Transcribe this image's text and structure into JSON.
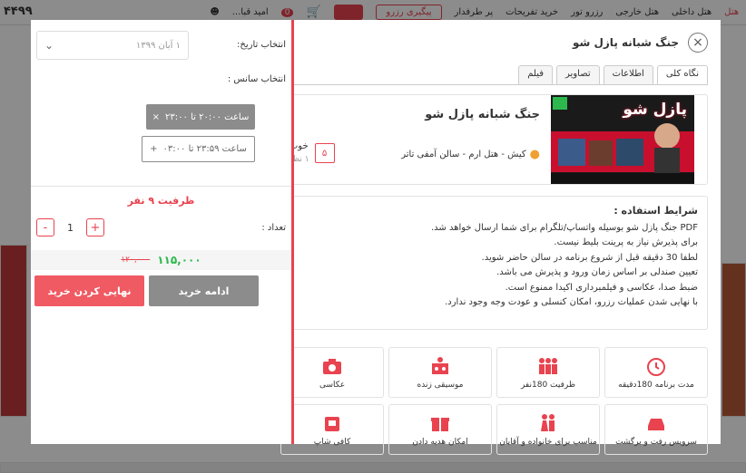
{
  "topbar": {
    "phone": "۴۴۹۹",
    "user": "امید قبا...",
    "cart_count": "0",
    "nav": [
      "هتل داخلی",
      "هتل خارجی",
      "رزرو تور",
      "خرید تفریحات",
      "پر طرفدار"
    ],
    "track_label": "پیگیری رزرو",
    "first_label": "هتل"
  },
  "modal": {
    "title": "جنگ شبانه پازل شو",
    "tabs": [
      "نگاه کلی",
      "اطلاعات",
      "تصاویر",
      "فیلم"
    ],
    "event": {
      "title": "جنگ شبانه پازل شو",
      "location": "کیش - هتل ارم - سالن آمفی تاتر",
      "rating_value": "۵",
      "rating_label": "خوب",
      "rating_count": "۱ نظر",
      "poster_text": "پازل شو"
    },
    "terms": {
      "heading": "شرایط استفاده :",
      "lines": [
        "PDF جنگ پازل شو بوسیله واتساپ/تلگرام برای شما ارسال خواهد شد.",
        "برای پذیرش نیاز به پرینت بلیط نیست.",
        "لطفا 30 دقیقه قبل از شروع برنامه در سالن حاضر شوید.",
        "تعیین صندلی بر اساس زمان ورود و پذیرش می باشد.",
        "ضبط صدا، عکاسی و فیلمبرداری اکیدا ممنوع است.",
        "با نهایی شدن عملیات رزرو، امکان کنسلی و عودت وجه وجود ندارد."
      ]
    },
    "features": [
      {
        "icon": "clock-icon",
        "label": "مدت برنامه 180دقیقه"
      },
      {
        "icon": "people-icon",
        "label": "ظرفیت 180نفر"
      },
      {
        "icon": "music-icon",
        "label": "موسیقی زنده"
      },
      {
        "icon": "camera-icon",
        "label": "عکاسی"
      },
      {
        "icon": "car-icon",
        "label": "سرویس رفت و برگشت"
      },
      {
        "icon": "family-icon",
        "label": "مناسب برای خانواده و آقایان"
      },
      {
        "icon": "gift-icon",
        "label": "امکان هدیه دادن"
      },
      {
        "icon": "cafe-icon",
        "label": "کافی شاپ"
      }
    ]
  },
  "booking": {
    "date_label": "انتخاب تاریخ:",
    "date_value": "۱ آبان ۱۳۹۹",
    "session_label": "انتخاب سانس :",
    "session_selected": "ساعت ۲۰:۰۰ تا ۲۳:۰۰",
    "session_other": "ساعت ۲۳:۵۹ تا ۰۳:۰۰",
    "capacity": "ظرفیت ۹ نفر",
    "qty_label": "تعداد :",
    "qty_value": "1",
    "price_new": "۱۱۵,۰۰۰",
    "price_old": "۱۲۰,۰۰۰",
    "continue_label": "ادامه خرید",
    "finalize_label": "نهایی کردن خرید"
  },
  "colors": {
    "accent": "#e8434f",
    "green": "#2db84d",
    "gray_button": "#8c8c8c"
  }
}
